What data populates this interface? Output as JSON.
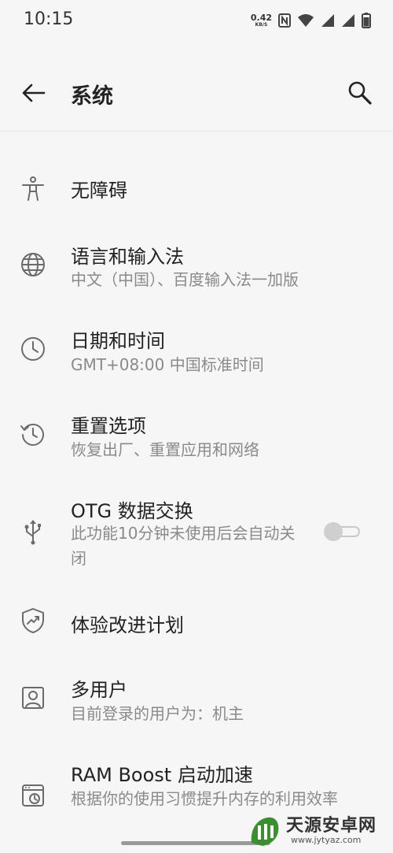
{
  "status": {
    "time": "10:15",
    "net_speed_value": "0.42",
    "net_speed_unit": "KB/S",
    "icons": [
      "nfc-icon",
      "wifi-icon",
      "signal-icon",
      "signal-icon",
      "battery-icon"
    ]
  },
  "header": {
    "title": "系统",
    "back_icon": "arrow-left-icon",
    "search_icon": "search-icon"
  },
  "settings": [
    {
      "icon": "accessibility-icon",
      "title": "无障碍"
    },
    {
      "icon": "globe-icon",
      "title": "语言和输入法",
      "subtitle": "中文（中国）、百度输入法一加版"
    },
    {
      "icon": "clock-icon",
      "title": "日期和时间",
      "subtitle": "GMT+08:00 中国标准时间"
    },
    {
      "icon": "reset-history-icon",
      "title": "重置选项",
      "subtitle": "恢复出厂、重置应用和网络"
    },
    {
      "icon": "usb-icon",
      "title": "OTG 数据交换",
      "subtitle": "此功能10分钟未使用后会自动关闭",
      "toggle_on": false
    },
    {
      "icon": "shield-trend-icon",
      "title": "体验改进计划"
    },
    {
      "icon": "user-icon",
      "title": "多用户",
      "subtitle": "目前登录的用户为：机主"
    },
    {
      "icon": "ram-boost-icon",
      "title": "RAM Boost 启动加速",
      "subtitle": "根据你的使用习惯提升内存的利用效率"
    }
  ],
  "watermark": {
    "text": "天源安卓网",
    "url": "www.jytyaz.com"
  }
}
